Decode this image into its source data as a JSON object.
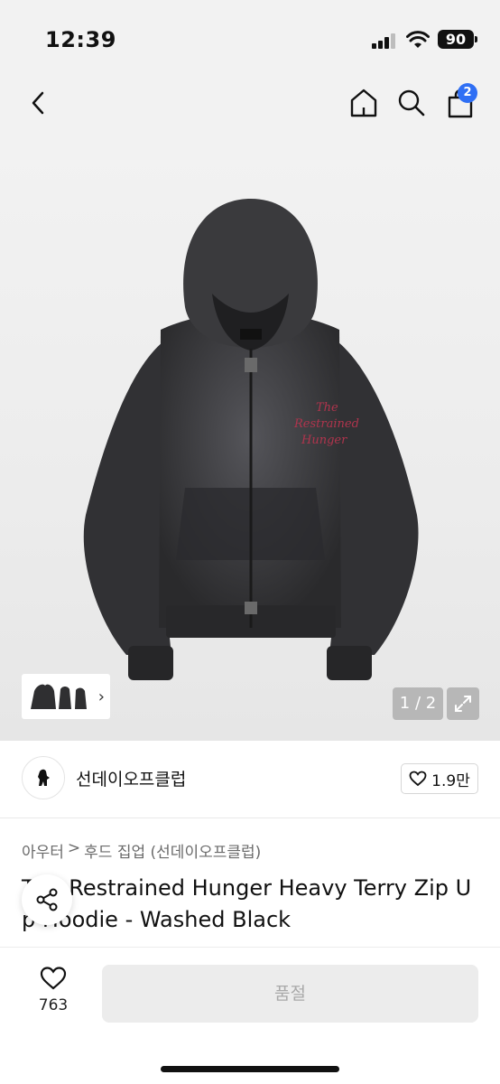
{
  "status_bar": {
    "time": "12:39",
    "battery": "90"
  },
  "nav": {
    "cart_count": "2"
  },
  "gallery": {
    "page_indicator": "1 / 2"
  },
  "product_art": {
    "print_line1": "The",
    "print_line2": "Restrained",
    "print_line3": "Hunger"
  },
  "shop": {
    "name": "선데이오프클럽",
    "likes": "1.9만"
  },
  "breadcrumb": {
    "category": "아우터",
    "separator": ">",
    "subcategory": "후드 집업 (선데이오프클럽)"
  },
  "product": {
    "title": "The Restrained Hunger Heavy Terry Zip Up Hoodie - Washed Black"
  },
  "bottom_bar": {
    "wish_count": "763",
    "buy_label": "품절"
  },
  "colors": {
    "accent": "#2f6ff4",
    "soldout_bg": "#ececec",
    "garment": "#2e2e30",
    "print": "#b0344d"
  }
}
